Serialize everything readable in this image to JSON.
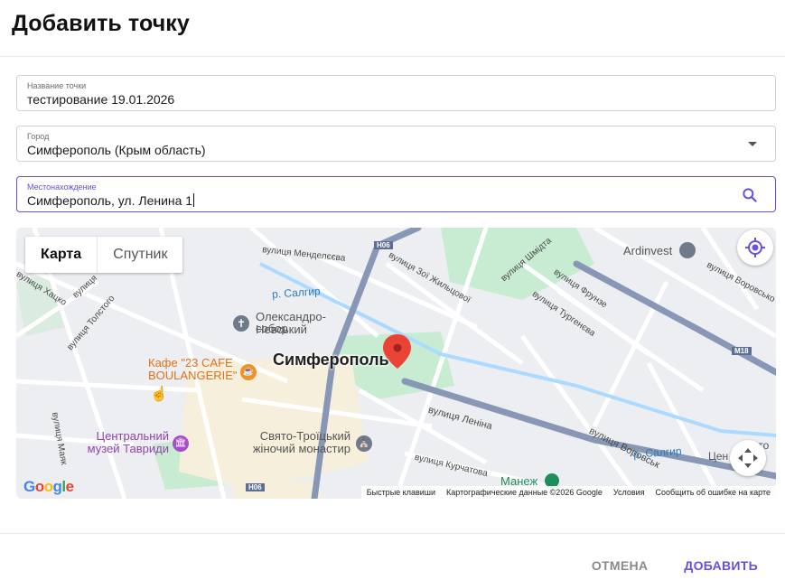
{
  "dialog": {
    "title": "Добавить точку"
  },
  "fields": {
    "name": {
      "label": "Название точки",
      "value": "тестирование 19.01.2026"
    },
    "city": {
      "label": "Город",
      "value": "Симферополь (Крым область)"
    },
    "location": {
      "label": "Местонахождение",
      "value": "Симферополь, ул. Ленина 1"
    }
  },
  "map": {
    "type_buttons": {
      "map": "Карта",
      "satellite": "Спутник"
    },
    "city_label": "Симферополь",
    "streets": {
      "mendeleeva": "вулиця Менделєєва",
      "zoi": "вулиця Зої Жильцової",
      "shmidta": "вулиця Шмідта",
      "frunze": "вулиця Фрунзе",
      "turheneva": "вулиця Тургенєва",
      "vorovsko": "вулиця Воровсько",
      "tolstoho": "вулиця Толстого",
      "khatsko": "вулиця Хацко",
      "vulytsia": "вулиця",
      "lenina": "вулиця Леніна",
      "vorovskoho": "вулиця Воровськ",
      "kurchatova": "вулиця Курчатова",
      "mayakova": "вулиця Маяк"
    },
    "rivers": {
      "salhyr_top": "р. Салгир",
      "salhyr_bottom": "р. Салгир"
    },
    "road_shields": {
      "h06_top": "H06",
      "h06_bottom": "H06",
      "m18": "M18"
    },
    "pois": {
      "nevsky": "Олександро-Невський собор",
      "nevsky_line1": "Олександро-Невський",
      "nevsky_line2": "собор",
      "cafe_line1": "Кафе \"23 CAFE",
      "cafe_line2": "BOULANGERIE\"",
      "museum_line1": "Центральний",
      "museum_line2": "музей Тавриди",
      "monastery_line1": "Свято-Троїцький",
      "monastery_line2": "жіночий монастир",
      "ardinvest": "Ardinvest",
      "manezh": "Манеж",
      "tsen": "Цен",
      "ceto": "ето"
    },
    "attribution": {
      "shortcuts": "Быстрые клавиши",
      "data": "Картографические данные ©2026 Google",
      "terms": "Условия",
      "report": "Сообщить об ошибке на карте"
    },
    "logo": "Google"
  },
  "actions": {
    "cancel": "ОТМЕНА",
    "add": "ДОБАВИТЬ"
  },
  "colors": {
    "accent": "#6a4fdc",
    "marker": "#ea4335",
    "park": "#c8ecd2",
    "water": "#aadaff"
  }
}
